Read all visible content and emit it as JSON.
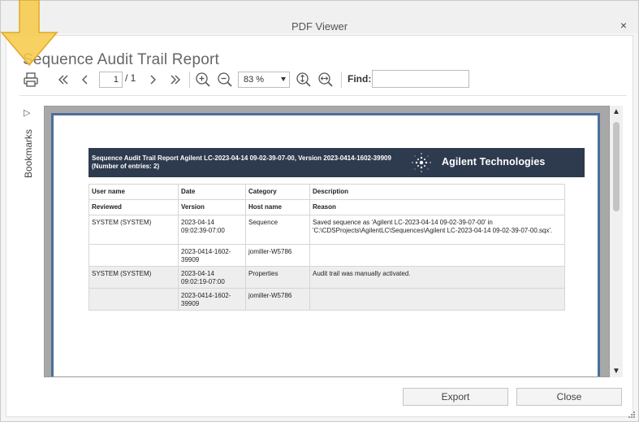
{
  "window": {
    "title": "PDF Viewer",
    "close_glyph": "×"
  },
  "report_title": "Sequence Audit Trail Report",
  "toolbar": {
    "print_icon": "printer-icon",
    "page_value": "1",
    "page_total": "/ 1",
    "zoom_value": "83 %",
    "find_label": "Find:",
    "find_value": ""
  },
  "bookmarks": {
    "label": "Bookmarks",
    "arrow": "▷"
  },
  "document": {
    "header_text": "Sequence Audit Trail Report Agilent LC-2023-04-14 09-02-39-07-00, Version 2023-0414-1602-39909 (Number of entries: 2)",
    "brand": "Agilent Technologies",
    "header_accent": "#2e3b4e",
    "table": {
      "headers": [
        [
          "User name",
          "Date",
          "Category",
          "Description"
        ],
        [
          "Reviewed",
          "Version",
          "Host name",
          "Reason"
        ]
      ],
      "rows": [
        [
          "SYSTEM (SYSTEM)",
          "2023-04-14 09:02:39-07:00",
          "Sequence",
          "Saved sequence as 'Agilent LC-2023-04-14 09-02-39-07-00' in 'C:\\CDSProjects\\AgilentLC\\Sequences\\Agilent LC-2023-04-14 09-02-39-07-00.sqx'."
        ],
        [
          "",
          "2023-0414-1602-39909",
          "jomiller-W5786",
          ""
        ],
        [
          "SYSTEM (SYSTEM)",
          "2023-04-14 09:02:19-07:00",
          "Properties",
          "Audit trail was manually activated."
        ],
        [
          "",
          "2023-0414-1602-39909",
          "jomiller-W5786",
          ""
        ]
      ]
    }
  },
  "buttons": {
    "export": "Export",
    "close": "Close"
  },
  "colors": {
    "page_border": "#4a6f9a",
    "highlight_arrow": "#f7c948"
  }
}
